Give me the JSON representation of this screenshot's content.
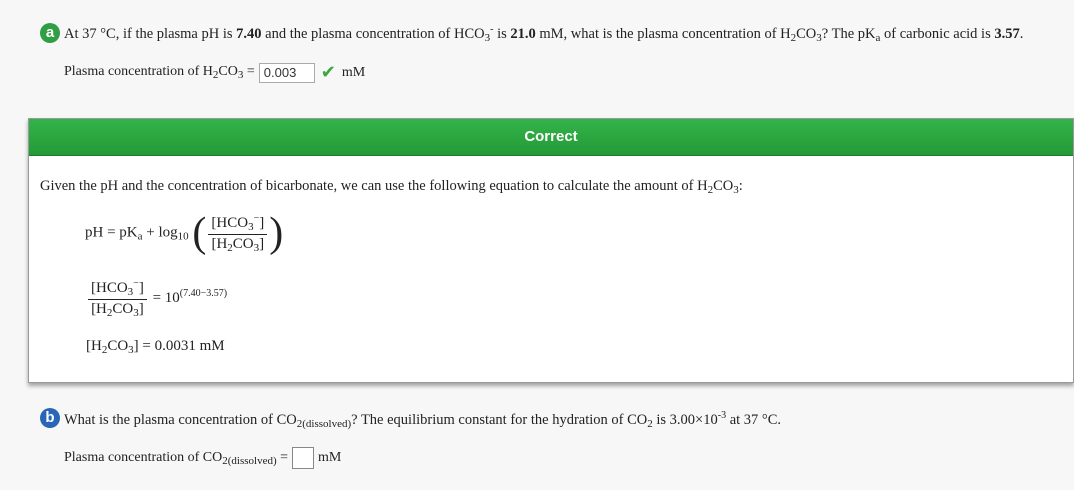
{
  "question_a": {
    "badge": "a",
    "badge_color": "#2f9e44",
    "text_1": "At 37 °C, if the plasma pH is ",
    "ph": "7.40",
    "text_2": " and the plasma concentration of HCO",
    "text_2_sub": "3",
    "text_2_sup": "-",
    "text_3": " is ",
    "hco3": "21.0",
    "text_4": " mM, what is the plasma concentration of H",
    "h_sub": "2",
    "text_5": "CO",
    "co_sub": "3",
    "text_6": "? The pK",
    "pka_sub": "a",
    "text_7": " of carbonic acid is ",
    "pka": "3.57",
    "text_8": ".",
    "answer_label_1": "Plasma concentration of H",
    "answer_label_sub1": "2",
    "answer_label_2": "CO",
    "answer_label_sub2": "3",
    "answer_label_3": " = ",
    "answer_value": "0.003",
    "answer_unit": "mM"
  },
  "feedback": {
    "title": "Correct",
    "header_color": "#2ea843",
    "explanation_1": "Given the pH and the concentration of bicarbonate, we can use the following equation to calculate the amount of H",
    "explanation_sub1": "2",
    "explanation_2": "CO",
    "explanation_sub2": "3",
    "explanation_3": ":",
    "eq1_lhs": "pH = pK",
    "eq1_lhs_sub": "a",
    "eq1_plus": " + log",
    "eq1_log_sub": "10",
    "frac_num": "[HCO",
    "frac_num_sub": "3",
    "frac_num_sup": "−",
    "frac_num_end": "]",
    "frac_den": "[H",
    "frac_den_sub": "2",
    "frac_den_mid": "CO",
    "frac_den_sub2": "3",
    "frac_den_end": "]",
    "eq2_rhs": "= 10",
    "eq2_exp": "(7.40−3.57)",
    "eq3_lhs": "[H",
    "eq3_sub": "2",
    "eq3_mid": "CO",
    "eq3_sub2": "3",
    "eq3_rhs": "] = 0.0031 mM"
  },
  "question_b": {
    "badge": "b",
    "badge_color": "#2a66b8",
    "text_1": "What is the plasma concentration of CO",
    "text_1_sub": "2(dissolved)",
    "text_2": "? The equilibrium constant for the hydration of CO",
    "text_2_sub": "2",
    "text_3": " is 3.00×10",
    "text_3_sup": "-3",
    "text_4": " at 37 °C.",
    "answer_label": "Plasma concentration of CO",
    "answer_label_sub": "2(dissolved)",
    "answer_eq": " = ",
    "answer_value": "",
    "answer_unit": "mM"
  }
}
